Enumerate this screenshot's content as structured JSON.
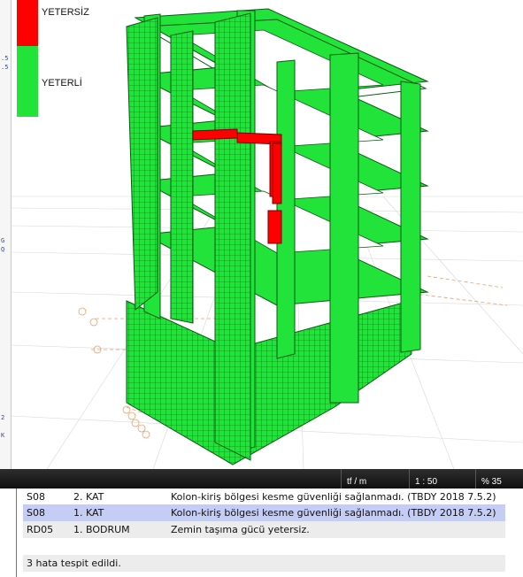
{
  "legend": {
    "items": [
      {
        "label": "YETERSİZ",
        "color": "#ff0000"
      },
      {
        "label": "YETERLİ",
        "color": "#22e33a"
      }
    ]
  },
  "status_bar": {
    "unit": "tf / m",
    "scale": "1 : 50",
    "zoom": "% 35"
  },
  "errors": {
    "rows": [
      {
        "code": "S08",
        "floor": "2. KAT",
        "message": "Kolon-kiriş bölgesi kesme güvenliği sağlanmadı. (TBDY 2018 7.5.2)"
      },
      {
        "code": "S08",
        "floor": "1. KAT",
        "message": "Kolon-kiriş bölgesi kesme güvenliği sağlanmadı. (TBDY 2018 7.5.2)"
      },
      {
        "code": "RD05",
        "floor": "1. BODRUM",
        "message": "Zemin taşıma gücü yetersiz."
      }
    ],
    "summary": "3 hata tespit edildi."
  },
  "colors": {
    "ok": "#22e33a",
    "fail": "#ff0000",
    "edge": "#0a5a12"
  }
}
